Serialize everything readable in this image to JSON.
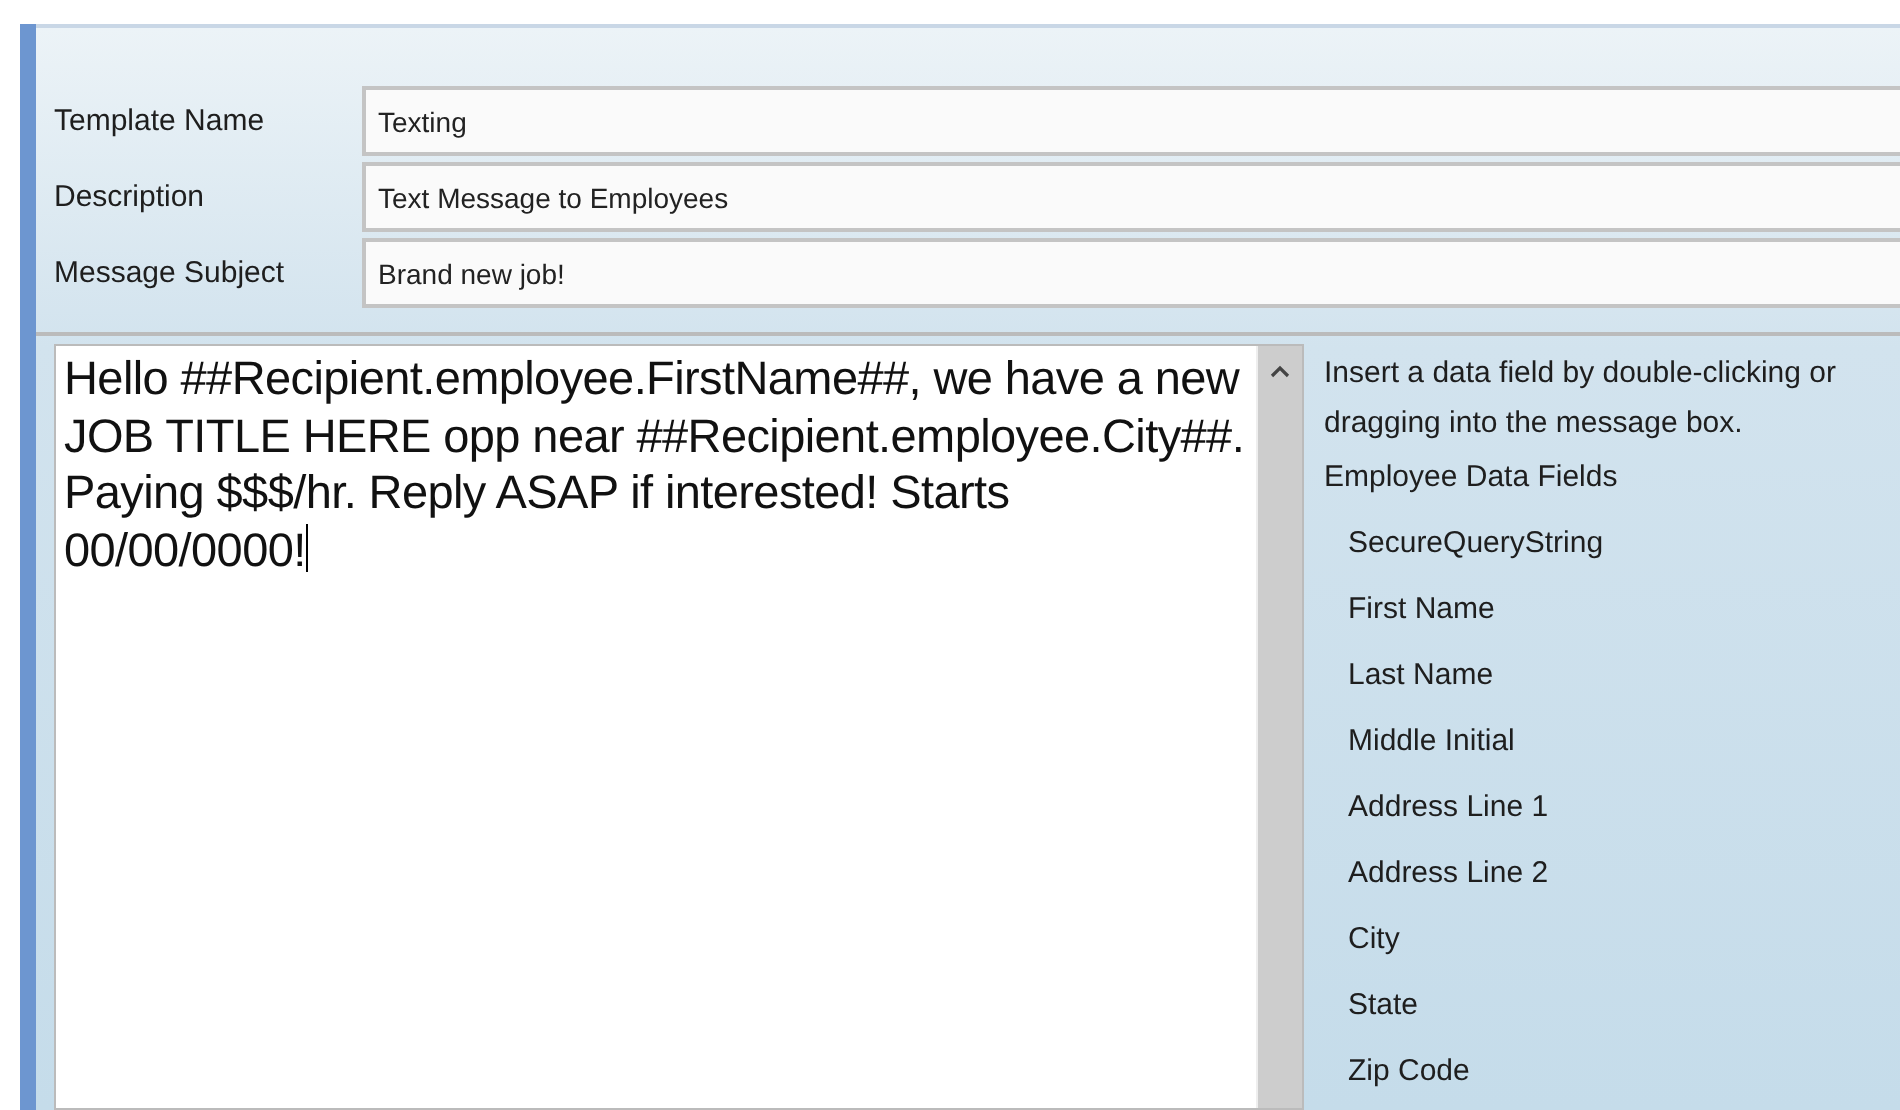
{
  "form": {
    "fields": [
      {
        "label": "Template Name",
        "value": "Texting"
      },
      {
        "label": "Description",
        "value": "Text Message to Employees"
      },
      {
        "label": "Message Subject",
        "value": "Brand new job!"
      }
    ]
  },
  "message": {
    "value": "Hello ##Recipient.employee.FirstName##, we have a new JOB TITLE HERE opp near ##Recipient.employee.City##. Paying $$$/hr. Reply ASAP if interested! Starts 00/00/0000!"
  },
  "data_fields": {
    "hint": "Insert a data field by double-clicking or dragging into the message box.",
    "group": "Employee Data Fields",
    "items": [
      "SecureQueryString",
      "First Name",
      "Last Name",
      "Middle Initial",
      "Address Line 1",
      "Address Line 2",
      "City",
      "State",
      "Zip Code"
    ]
  }
}
